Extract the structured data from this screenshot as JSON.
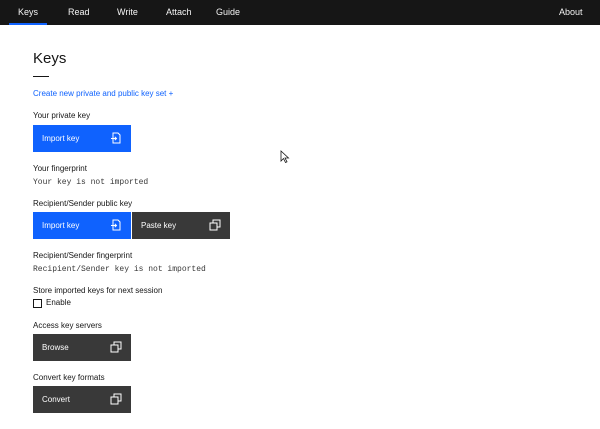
{
  "nav": {
    "items": [
      {
        "label": "Keys",
        "active": true
      },
      {
        "label": "Read"
      },
      {
        "label": "Write"
      },
      {
        "label": "Attach"
      },
      {
        "label": "Guide"
      }
    ],
    "about_label": "About"
  },
  "page": {
    "title": "Keys",
    "create_link": "Create new private and public key set +"
  },
  "private_key": {
    "label": "Your private key",
    "import_button": "Import key",
    "import_icon": "import-file-icon"
  },
  "fingerprint": {
    "label": "Your fingerprint",
    "value": "Your key is not imported"
  },
  "public_key": {
    "label": "Recipient/Sender public key",
    "import_button": "Import key",
    "paste_button": "Paste key",
    "import_icon": "import-file-icon",
    "paste_icon": "copy-icon"
  },
  "recipient_fingerprint": {
    "label": "Recipient/Sender fingerprint",
    "value": "Recipient/Sender key is not imported"
  },
  "store": {
    "label": "Store imported keys for next session",
    "checkbox_label": "Enable",
    "checked": false
  },
  "key_servers": {
    "label": "Access key servers",
    "button": "Browse",
    "icon": "launch-icon"
  },
  "convert": {
    "label": "Convert key formats",
    "button": "Convert",
    "icon": "launch-icon"
  },
  "colors": {
    "nav_bg": "#161616",
    "primary": "#0f62fe",
    "secondary": "#393939",
    "link": "#0f62fe"
  }
}
